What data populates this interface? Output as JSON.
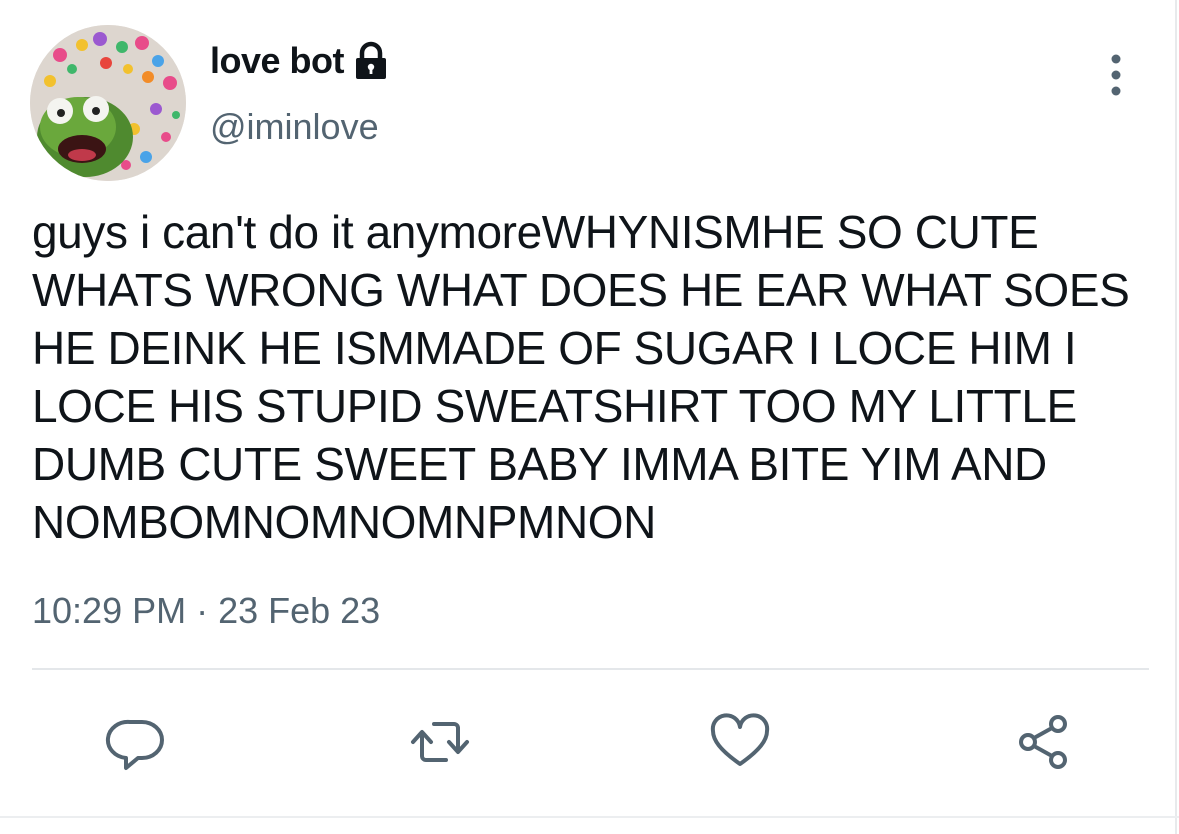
{
  "tweet": {
    "author": {
      "display_name": "love bot",
      "handle": "@iminlove",
      "protected_icon": "lock-icon",
      "avatar_description_icon": "avatar"
    },
    "text": "guys i can't do it anymoreWHYNISMHE SO CUTE WHATS WRONG WHAT DOES HE EAR WHAT SOES HE DEINK HE ISMMADE OF SUGAR I LOCE HIM I LOCE HIS STUPID SWEATSHIRT TOO MY LITTLE DUMB CUTE SWEET BABY IMMA BITE YIM AND NOMBOMNOMNOMNPMNON",
    "timestamp": "10:29 PM · 23 Feb 23"
  },
  "actions": [
    {
      "name": "reply",
      "icon": "reply-icon"
    },
    {
      "name": "retweet",
      "icon": "retweet-icon"
    },
    {
      "name": "like",
      "icon": "heart-icon"
    },
    {
      "name": "share",
      "icon": "share-icon"
    }
  ],
  "colors": {
    "text": "#0f1419",
    "secondary": "#536471",
    "divider": "#e4e7ea"
  }
}
